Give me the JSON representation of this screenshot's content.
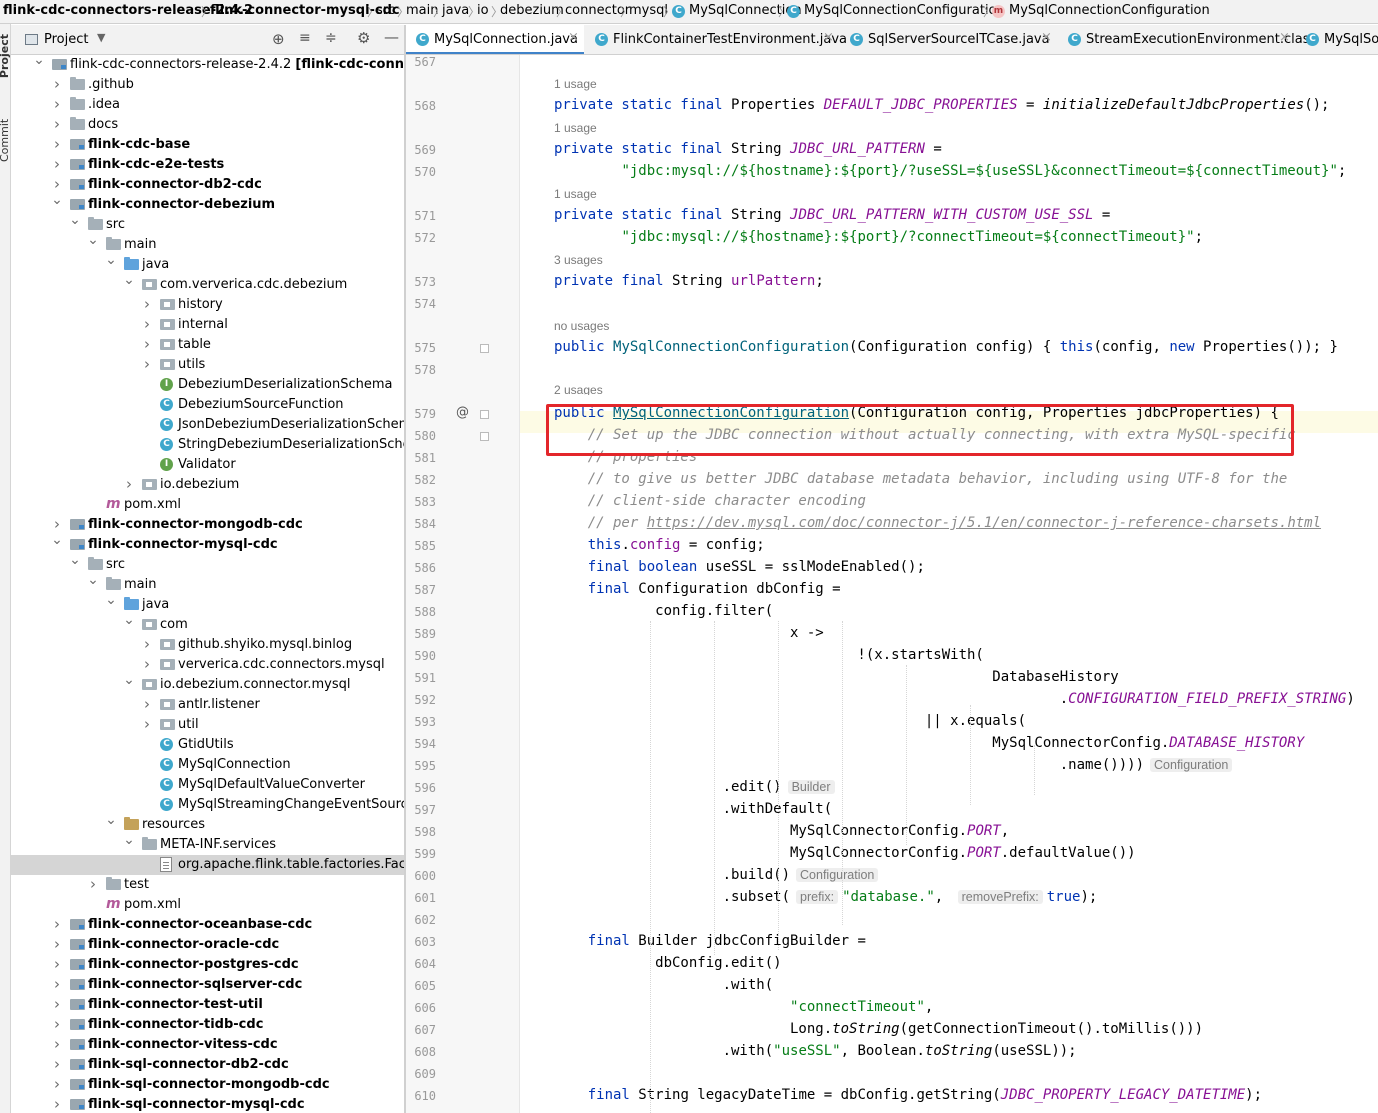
{
  "breadcrumb": [
    {
      "label": "flink-cdc-connectors-release-2.4.2",
      "bold": true
    },
    {
      "label": "flink-connector-mysql-cdc",
      "bold": true
    },
    {
      "label": "src"
    },
    {
      "label": "main"
    },
    {
      "label": "java"
    },
    {
      "label": "io"
    },
    {
      "label": "debezium"
    },
    {
      "label": "connector"
    },
    {
      "label": "mysql"
    },
    {
      "label": "MySqlConnection",
      "icon": "class"
    },
    {
      "label": "MySqlConnectionConfiguration",
      "icon": "class"
    },
    {
      "label": "MySqlConnectionConfiguration",
      "icon": "method"
    }
  ],
  "side_stripe": {
    "project_label": "Project",
    "commit_label": "Commit"
  },
  "project_panel": {
    "title": "Project"
  },
  "tree": [
    {
      "label": "flink-cdc-connectors-release-2.4.2 [flink-cdc-connectors]",
      "suffix": "D",
      "depth": 0,
      "arrow": "open",
      "icon": "module"
    },
    {
      "label": ".github",
      "depth": 1,
      "arrow": "closed",
      "icon": "folder"
    },
    {
      "label": ".idea",
      "depth": 1,
      "arrow": "closed",
      "icon": "folder"
    },
    {
      "label": "docs",
      "depth": 1,
      "arrow": "closed",
      "icon": "folder"
    },
    {
      "label": "flink-cdc-base",
      "depth": 1,
      "arrow": "closed",
      "icon": "module",
      "bold": true
    },
    {
      "label": "flink-cdc-e2e-tests",
      "depth": 1,
      "arrow": "closed",
      "icon": "module",
      "bold": true
    },
    {
      "label": "flink-connector-db2-cdc",
      "depth": 1,
      "arrow": "closed",
      "icon": "module",
      "bold": true
    },
    {
      "label": "flink-connector-debezium",
      "depth": 1,
      "arrow": "open",
      "icon": "module",
      "bold": true
    },
    {
      "label": "src",
      "depth": 2,
      "arrow": "open",
      "icon": "folder"
    },
    {
      "label": "main",
      "depth": 3,
      "arrow": "open",
      "icon": "folder"
    },
    {
      "label": "java",
      "depth": 4,
      "arrow": "open",
      "icon": "src"
    },
    {
      "label": "com.ververica.cdc.debezium",
      "depth": 5,
      "arrow": "open",
      "icon": "package"
    },
    {
      "label": "history",
      "depth": 6,
      "arrow": "closed",
      "icon": "package"
    },
    {
      "label": "internal",
      "depth": 6,
      "arrow": "closed",
      "icon": "package"
    },
    {
      "label": "table",
      "depth": 6,
      "arrow": "closed",
      "icon": "package"
    },
    {
      "label": "utils",
      "depth": 6,
      "arrow": "closed",
      "icon": "package"
    },
    {
      "label": "DebeziumDeserializationSchema",
      "depth": 6,
      "icon": "interface"
    },
    {
      "label": "DebeziumSourceFunction",
      "depth": 6,
      "icon": "class"
    },
    {
      "label": "JsonDebeziumDeserializationSchema",
      "depth": 6,
      "icon": "class"
    },
    {
      "label": "StringDebeziumDeserializationSchema",
      "depth": 6,
      "icon": "class"
    },
    {
      "label": "Validator",
      "depth": 6,
      "icon": "interface"
    },
    {
      "label": "io.debezium",
      "depth": 5,
      "arrow": "closed",
      "icon": "package"
    },
    {
      "label": "pom.xml",
      "depth": 3,
      "icon": "maven"
    },
    {
      "label": "flink-connector-mongodb-cdc",
      "depth": 1,
      "arrow": "closed",
      "icon": "module",
      "bold": true
    },
    {
      "label": "flink-connector-mysql-cdc",
      "depth": 1,
      "arrow": "open",
      "icon": "module",
      "bold": true
    },
    {
      "label": "src",
      "depth": 2,
      "arrow": "open",
      "icon": "folder"
    },
    {
      "label": "main",
      "depth": 3,
      "arrow": "open",
      "icon": "folder"
    },
    {
      "label": "java",
      "depth": 4,
      "arrow": "open",
      "icon": "src"
    },
    {
      "label": "com",
      "depth": 5,
      "arrow": "open",
      "icon": "package"
    },
    {
      "label": "github.shyiko.mysql.binlog",
      "depth": 6,
      "arrow": "closed",
      "icon": "package"
    },
    {
      "label": "ververica.cdc.connectors.mysql",
      "depth": 6,
      "arrow": "closed",
      "icon": "package"
    },
    {
      "label": "io.debezium.connector.mysql",
      "depth": 5,
      "arrow": "open",
      "icon": "package"
    },
    {
      "label": "antlr.listener",
      "depth": 6,
      "arrow": "closed",
      "icon": "package"
    },
    {
      "label": "util",
      "depth": 6,
      "arrow": "closed",
      "icon": "package"
    },
    {
      "label": "GtidUtils",
      "depth": 6,
      "icon": "class"
    },
    {
      "label": "MySqlConnection",
      "depth": 6,
      "icon": "class"
    },
    {
      "label": "MySqlDefaultValueConverter",
      "depth": 6,
      "icon": "class"
    },
    {
      "label": "MySqlStreamingChangeEventSource",
      "depth": 6,
      "icon": "class"
    },
    {
      "label": "resources",
      "depth": 4,
      "arrow": "open",
      "icon": "res"
    },
    {
      "label": "META-INF.services",
      "depth": 5,
      "arrow": "open",
      "icon": "folder"
    },
    {
      "label": "org.apache.flink.table.factories.Factory",
      "depth": 6,
      "icon": "file",
      "selected": true
    },
    {
      "label": "test",
      "depth": 3,
      "arrow": "closed",
      "icon": "folder"
    },
    {
      "label": "pom.xml",
      "depth": 3,
      "icon": "maven"
    },
    {
      "label": "flink-connector-oceanbase-cdc",
      "depth": 1,
      "arrow": "closed",
      "icon": "module",
      "bold": true
    },
    {
      "label": "flink-connector-oracle-cdc",
      "depth": 1,
      "arrow": "closed",
      "icon": "module",
      "bold": true
    },
    {
      "label": "flink-connector-postgres-cdc",
      "depth": 1,
      "arrow": "closed",
      "icon": "module",
      "bold": true
    },
    {
      "label": "flink-connector-sqlserver-cdc",
      "depth": 1,
      "arrow": "closed",
      "icon": "module",
      "bold": true
    },
    {
      "label": "flink-connector-test-util",
      "depth": 1,
      "arrow": "closed",
      "icon": "module",
      "bold": true
    },
    {
      "label": "flink-connector-tidb-cdc",
      "depth": 1,
      "arrow": "closed",
      "icon": "module",
      "bold": true
    },
    {
      "label": "flink-connector-vitess-cdc",
      "depth": 1,
      "arrow": "closed",
      "icon": "module",
      "bold": true
    },
    {
      "label": "flink-sql-connector-db2-cdc",
      "depth": 1,
      "arrow": "closed",
      "icon": "module",
      "bold": true
    },
    {
      "label": "flink-sql-connector-mongodb-cdc",
      "depth": 1,
      "arrow": "closed",
      "icon": "module",
      "bold": true
    },
    {
      "label": "flink-sql-connector-mysql-cdc",
      "depth": 1,
      "arrow": "closed",
      "icon": "module",
      "bold": true
    }
  ],
  "tabs": [
    {
      "label": "MySqlConnection.java",
      "active": true,
      "icon": "class"
    },
    {
      "label": "FlinkContainerTestEnvironment.java",
      "icon": "class"
    },
    {
      "label": "SqlServerSourceITCase.java",
      "icon": "class"
    },
    {
      "label": "StreamExecutionEnvironment.class",
      "icon": "class"
    },
    {
      "label": "MySqlSou",
      "icon": "class"
    }
  ],
  "code": [
    {
      "kind": "line",
      "num": "567",
      "tokens": [
        [
          "p",
          "               "
        ],
        [
          "p",
          "                   "
        ]
      ]
    },
    {
      "kind": "usage",
      "text": "1 usage"
    },
    {
      "kind": "line",
      "num": "568",
      "tokens": [
        [
          "k",
          "private static final "
        ],
        [
          "p",
          "Properties "
        ],
        [
          "sf",
          "DEFAULT_JDBC_PROPERTIES"
        ],
        [
          "p",
          " = "
        ],
        [
          "i",
          "initializeDefaultJdbcProperties"
        ],
        [
          "p",
          "();"
        ]
      ]
    },
    {
      "kind": "usage",
      "text": "1 usage"
    },
    {
      "kind": "line",
      "num": "569",
      "tokens": [
        [
          "k",
          "private static final "
        ],
        [
          "p",
          "String "
        ],
        [
          "sf",
          "JDBC_URL_PATTERN"
        ],
        [
          "p",
          " ="
        ]
      ]
    },
    {
      "kind": "line",
      "num": "570",
      "tokens": [
        [
          "p",
          "        "
        ],
        [
          "s",
          "\"jdbc:mysql://${hostname}:${port}/?useSSL=${useSSL}&connectTimeout=${connectTimeout}\""
        ],
        [
          "p",
          ";"
        ]
      ]
    },
    {
      "kind": "usage",
      "text": "1 usage"
    },
    {
      "kind": "line",
      "num": "571",
      "tokens": [
        [
          "k",
          "private static final "
        ],
        [
          "p",
          "String "
        ],
        [
          "sf",
          "JDBC_URL_PATTERN_WITH_CUSTOM_USE_SSL"
        ],
        [
          "p",
          " ="
        ]
      ]
    },
    {
      "kind": "line",
      "num": "572",
      "tokens": [
        [
          "p",
          "        "
        ],
        [
          "s",
          "\"jdbc:mysql://${hostname}:${port}/?connectTimeout=${connectTimeout}\""
        ],
        [
          "p",
          ";"
        ]
      ]
    },
    {
      "kind": "usage",
      "text": "3 usages"
    },
    {
      "kind": "line",
      "num": "573",
      "tokens": [
        [
          "k",
          "private final "
        ],
        [
          "p",
          "String "
        ],
        [
          "f",
          "urlPattern"
        ],
        [
          "p",
          ";"
        ]
      ]
    },
    {
      "kind": "line",
      "num": "574",
      "tokens": []
    },
    {
      "kind": "usage",
      "text": "no usages"
    },
    {
      "kind": "line",
      "num": "575",
      "tokens": [
        [
          "k",
          "public "
        ],
        [
          "fn",
          "MySqlConnectionConfiguration"
        ],
        [
          "p",
          "(Configuration config) { "
        ],
        [
          "k",
          "this"
        ],
        [
          "p",
          "(config, "
        ],
        [
          "k",
          "new "
        ],
        [
          "p",
          "Properties()); }"
        ]
      ]
    },
    {
      "kind": "line",
      "num": "578",
      "tokens": []
    },
    {
      "kind": "usage",
      "text": "2 usages"
    },
    {
      "kind": "line",
      "num": "579",
      "tokens": [
        [
          "k",
          "public "
        ],
        [
          "fnu",
          "MySqlConnectionConfiguration"
        ],
        [
          "p",
          "(Configuration config, Properties jdbcProperties) {"
        ]
      ],
      "current": true
    },
    {
      "kind": "line",
      "num": "580",
      "tokens": [
        [
          "p",
          "    "
        ],
        [
          "c",
          "// Set up the JDBC connection without actually connecting, with extra MySQL-specific"
        ]
      ]
    },
    {
      "kind": "line",
      "num": "581",
      "tokens": [
        [
          "p",
          "    "
        ],
        [
          "c",
          "// properties"
        ]
      ]
    },
    {
      "kind": "line",
      "num": "582",
      "tokens": [
        [
          "p",
          "    "
        ],
        [
          "c",
          "// to give us better JDBC database metadata behavior, including using UTF-8 for the"
        ]
      ]
    },
    {
      "kind": "line",
      "num": "583",
      "tokens": [
        [
          "p",
          "    "
        ],
        [
          "c",
          "// client-side character encoding"
        ]
      ]
    },
    {
      "kind": "line",
      "num": "584",
      "tokens": [
        [
          "p",
          "    "
        ],
        [
          "c",
          "// per "
        ],
        [
          "cu",
          "https://dev.mysql.com/doc/connector-j/5.1/en/connector-j-reference-charsets.html"
        ]
      ]
    },
    {
      "kind": "line",
      "num": "585",
      "tokens": [
        [
          "p",
          "    "
        ],
        [
          "k",
          "this"
        ],
        [
          "p",
          "."
        ],
        [
          "f",
          "config"
        ],
        [
          "p",
          " = config;"
        ]
      ]
    },
    {
      "kind": "line",
      "num": "586",
      "tokens": [
        [
          "p",
          "    "
        ],
        [
          "k",
          "final boolean "
        ],
        [
          "p",
          "useSSL = sslModeEnabled();"
        ]
      ]
    },
    {
      "kind": "line",
      "num": "587",
      "tokens": [
        [
          "p",
          "    "
        ],
        [
          "k",
          "final "
        ],
        [
          "p",
          "Configuration dbConfig ="
        ]
      ]
    },
    {
      "kind": "line",
      "num": "588",
      "tokens": [
        [
          "p",
          "            config.filter("
        ]
      ]
    },
    {
      "kind": "line",
      "num": "589",
      "tokens": [
        [
          "p",
          "                            x ->"
        ]
      ]
    },
    {
      "kind": "line",
      "num": "590",
      "tokens": [
        [
          "p",
          "                                    !(x.startsWith("
        ]
      ]
    },
    {
      "kind": "line",
      "num": "591",
      "tokens": [
        [
          "p",
          "                                                    DatabaseHistory"
        ]
      ]
    },
    {
      "kind": "line",
      "num": "592",
      "tokens": [
        [
          "p",
          "                                                            ."
        ],
        [
          "sf",
          "CONFIGURATION_FIELD_PREFIX_STRING"
        ],
        [
          "p",
          ")"
        ]
      ]
    },
    {
      "kind": "line",
      "num": "593",
      "tokens": [
        [
          "p",
          "                                            || x.equals("
        ]
      ]
    },
    {
      "kind": "line",
      "num": "594",
      "tokens": [
        [
          "p",
          "                                                    MySqlConnectorConfig."
        ],
        [
          "sf",
          "DATABASE_HISTORY"
        ]
      ]
    },
    {
      "kind": "line",
      "num": "595",
      "tokens": [
        [
          "p",
          "                                                            .name())))"
        ],
        [
          "h",
          "Configuration"
        ]
      ]
    },
    {
      "kind": "line",
      "num": "596",
      "tokens": [
        [
          "p",
          "                    .edit()"
        ],
        [
          "h",
          "Builder"
        ]
      ]
    },
    {
      "kind": "line",
      "num": "597",
      "tokens": [
        [
          "p",
          "                    .withDefault("
        ]
      ]
    },
    {
      "kind": "line",
      "num": "598",
      "tokens": [
        [
          "p",
          "                            MySqlConnectorConfig."
        ],
        [
          "sf",
          "PORT"
        ],
        [
          "p",
          ","
        ]
      ]
    },
    {
      "kind": "line",
      "num": "599",
      "tokens": [
        [
          "p",
          "                            MySqlConnectorConfig."
        ],
        [
          "sf",
          "PORT"
        ],
        [
          "p",
          ".defaultValue())"
        ]
      ]
    },
    {
      "kind": "line",
      "num": "600",
      "tokens": [
        [
          "p",
          "                    .build()"
        ],
        [
          "h",
          "Configuration"
        ]
      ]
    },
    {
      "kind": "line",
      "num": "601",
      "tokens": [
        [
          "p",
          "                    .subset("
        ],
        [
          "h",
          "prefix:"
        ],
        [
          "s",
          "\"database.\""
        ],
        [
          "p",
          ", "
        ],
        [
          "h",
          "removePrefix:"
        ],
        [
          "k",
          "true"
        ],
        [
          "p",
          ");"
        ]
      ]
    },
    {
      "kind": "line",
      "num": "602",
      "tokens": []
    },
    {
      "kind": "line",
      "num": "603",
      "tokens": [
        [
          "p",
          "    "
        ],
        [
          "k",
          "final "
        ],
        [
          "p",
          "Builder jdbcConfigBuilder ="
        ]
      ]
    },
    {
      "kind": "line",
      "num": "604",
      "tokens": [
        [
          "p",
          "            dbConfig.edit()"
        ]
      ]
    },
    {
      "kind": "line",
      "num": "605",
      "tokens": [
        [
          "p",
          "                    .with("
        ]
      ]
    },
    {
      "kind": "line",
      "num": "606",
      "tokens": [
        [
          "p",
          "                            "
        ],
        [
          "s",
          "\"connectTimeout\""
        ],
        [
          "p",
          ","
        ]
      ]
    },
    {
      "kind": "line",
      "num": "607",
      "tokens": [
        [
          "p",
          "                            Long."
        ],
        [
          "i",
          "toString"
        ],
        [
          "p",
          "(getConnectionTimeout().toMillis()))"
        ]
      ]
    },
    {
      "kind": "line",
      "num": "608",
      "tokens": [
        [
          "p",
          "                    .with("
        ],
        [
          "s",
          "\"useSSL\""
        ],
        [
          "p",
          ", Boolean."
        ],
        [
          "i",
          "toString"
        ],
        [
          "p",
          "(useSSL));"
        ]
      ]
    },
    {
      "kind": "line",
      "num": "609",
      "tokens": []
    },
    {
      "kind": "line",
      "num": "610",
      "tokens": [
        [
          "p",
          "    "
        ],
        [
          "k",
          "final "
        ],
        [
          "p",
          "String legacyDateTime = dbConfig.getString("
        ],
        [
          "sf",
          "JDBC_PROPERTY_LEGACY_DATETIME"
        ],
        [
          "p",
          ");"
        ]
      ]
    }
  ],
  "colors": {
    "accent": "#4083c9",
    "highlight_box": "#e3262a",
    "keyword": "#0033b3",
    "string": "#067d17",
    "comment": "#8c8c8c",
    "static_field": "#871094"
  }
}
